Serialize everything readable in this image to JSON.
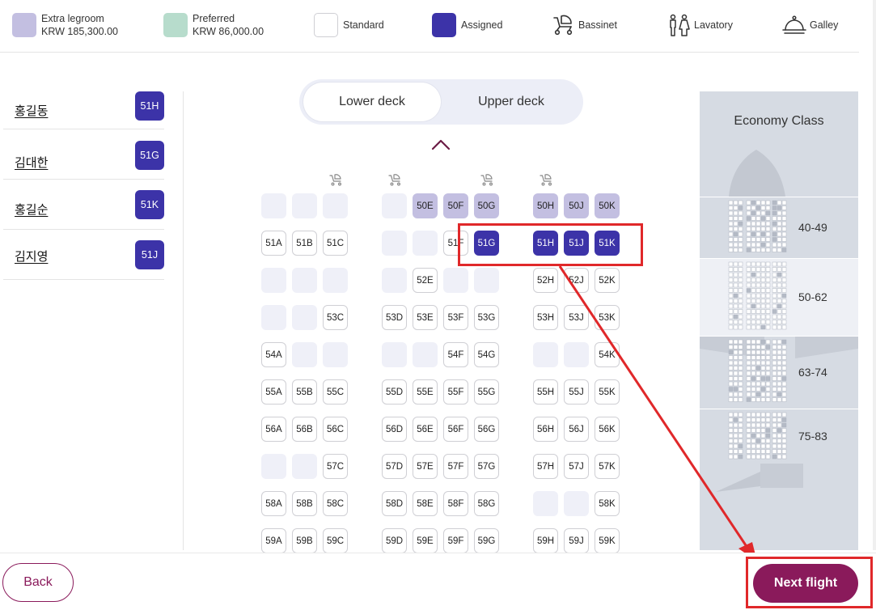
{
  "legend": {
    "extra_legroom": {
      "label": "Extra legroom",
      "price": "KRW 185,300.00",
      "color": "#c3bfe1"
    },
    "preferred": {
      "label": "Preferred",
      "price": "KRW 86,000.00",
      "color": "#b7dccc"
    },
    "standard": {
      "label": "Standard"
    },
    "assigned": {
      "label": "Assigned",
      "color": "#3c33a8"
    },
    "bassinet": {
      "label": "Bassinet",
      "icon": "stroller-icon"
    },
    "lavatory": {
      "label": "Lavatory",
      "icon": "lavatory-icon"
    },
    "galley": {
      "label": "Galley",
      "icon": "cloche-icon"
    }
  },
  "passengers": [
    {
      "name": "홍길동",
      "seat": "51H"
    },
    {
      "name": "김대한",
      "seat": "51G"
    },
    {
      "name": "홍길순",
      "seat": "51K"
    },
    {
      "name": "김지영",
      "seat": "51J"
    }
  ],
  "deck": {
    "lower": "Lower deck",
    "upper": "Upper deck",
    "selected": "Lower deck"
  },
  "seatmap": {
    "bassinet_rows": [
      "50"
    ],
    "rows": [
      {
        "row": "50",
        "seats": [
          {
            "l": "A",
            "s": "na"
          },
          {
            "l": "B",
            "s": "na"
          },
          {
            "l": "C",
            "s": "na"
          },
          {
            "l": "D",
            "s": "na"
          },
          {
            "l": "E",
            "s": "xl",
            "t": "50E"
          },
          {
            "l": "F",
            "s": "xl",
            "t": "50F"
          },
          {
            "l": "G",
            "s": "xl",
            "t": "50G"
          },
          {
            "l": "H",
            "s": "xl",
            "t": "50H"
          },
          {
            "l": "J",
            "s": "xl",
            "t": "50J"
          },
          {
            "l": "K",
            "s": "xl",
            "t": "50K"
          }
        ]
      },
      {
        "row": "51",
        "seats": [
          {
            "l": "A",
            "s": "std",
            "t": "51A"
          },
          {
            "l": "B",
            "s": "std",
            "t": "51B"
          },
          {
            "l": "C",
            "s": "std",
            "t": "51C"
          },
          {
            "l": "D",
            "s": "na"
          },
          {
            "l": "E",
            "s": "na"
          },
          {
            "l": "F",
            "s": "std",
            "t": "51F"
          },
          {
            "l": "G",
            "s": "asg",
            "t": "51G"
          },
          {
            "l": "H",
            "s": "asg",
            "t": "51H"
          },
          {
            "l": "J",
            "s": "asg",
            "t": "51J"
          },
          {
            "l": "K",
            "s": "asg",
            "t": "51K"
          }
        ]
      },
      {
        "row": "52",
        "seats": [
          {
            "l": "A",
            "s": "na"
          },
          {
            "l": "B",
            "s": "na"
          },
          {
            "l": "C",
            "s": "na"
          },
          {
            "l": "D",
            "s": "na"
          },
          {
            "l": "E",
            "s": "std",
            "t": "52E"
          },
          {
            "l": "F",
            "s": "na"
          },
          {
            "l": "G",
            "s": "na"
          },
          {
            "l": "H",
            "s": "std",
            "t": "52H"
          },
          {
            "l": "J",
            "s": "std",
            "t": "52J"
          },
          {
            "l": "K",
            "s": "std",
            "t": "52K"
          }
        ]
      },
      {
        "row": "53",
        "seats": [
          {
            "l": "A",
            "s": "na"
          },
          {
            "l": "B",
            "s": "na"
          },
          {
            "l": "C",
            "s": "std",
            "t": "53C"
          },
          {
            "l": "D",
            "s": "std",
            "t": "53D"
          },
          {
            "l": "E",
            "s": "std",
            "t": "53E"
          },
          {
            "l": "F",
            "s": "std",
            "t": "53F"
          },
          {
            "l": "G",
            "s": "std",
            "t": "53G"
          },
          {
            "l": "H",
            "s": "std",
            "t": "53H"
          },
          {
            "l": "J",
            "s": "std",
            "t": "53J"
          },
          {
            "l": "K",
            "s": "std",
            "t": "53K"
          }
        ]
      },
      {
        "row": "54",
        "seats": [
          {
            "l": "A",
            "s": "std",
            "t": "54A"
          },
          {
            "l": "B",
            "s": "na"
          },
          {
            "l": "C",
            "s": "na"
          },
          {
            "l": "D",
            "s": "na"
          },
          {
            "l": "E",
            "s": "na"
          },
          {
            "l": "F",
            "s": "std",
            "t": "54F"
          },
          {
            "l": "G",
            "s": "std",
            "t": "54G"
          },
          {
            "l": "H",
            "s": "na"
          },
          {
            "l": "J",
            "s": "na"
          },
          {
            "l": "K",
            "s": "std",
            "t": "54K"
          }
        ]
      },
      {
        "row": "55",
        "seats": [
          {
            "l": "A",
            "s": "std",
            "t": "55A"
          },
          {
            "l": "B",
            "s": "std",
            "t": "55B"
          },
          {
            "l": "C",
            "s": "std",
            "t": "55C"
          },
          {
            "l": "D",
            "s": "std",
            "t": "55D"
          },
          {
            "l": "E",
            "s": "std",
            "t": "55E"
          },
          {
            "l": "F",
            "s": "std",
            "t": "55F"
          },
          {
            "l": "G",
            "s": "std",
            "t": "55G"
          },
          {
            "l": "H",
            "s": "std",
            "t": "55H"
          },
          {
            "l": "J",
            "s": "std",
            "t": "55J"
          },
          {
            "l": "K",
            "s": "std",
            "t": "55K"
          }
        ]
      },
      {
        "row": "56",
        "seats": [
          {
            "l": "A",
            "s": "std",
            "t": "56A"
          },
          {
            "l": "B",
            "s": "std",
            "t": "56B"
          },
          {
            "l": "C",
            "s": "std",
            "t": "56C"
          },
          {
            "l": "D",
            "s": "std",
            "t": "56D"
          },
          {
            "l": "E",
            "s": "std",
            "t": "56E"
          },
          {
            "l": "F",
            "s": "std",
            "t": "56F"
          },
          {
            "l": "G",
            "s": "std",
            "t": "56G"
          },
          {
            "l": "H",
            "s": "std",
            "t": "56H"
          },
          {
            "l": "J",
            "s": "std",
            "t": "56J"
          },
          {
            "l": "K",
            "s": "std",
            "t": "56K"
          }
        ]
      },
      {
        "row": "57",
        "seats": [
          {
            "l": "A",
            "s": "na"
          },
          {
            "l": "B",
            "s": "na"
          },
          {
            "l": "C",
            "s": "std",
            "t": "57C"
          },
          {
            "l": "D",
            "s": "std",
            "t": "57D"
          },
          {
            "l": "E",
            "s": "std",
            "t": "57E"
          },
          {
            "l": "F",
            "s": "std",
            "t": "57F"
          },
          {
            "l": "G",
            "s": "std",
            "t": "57G"
          },
          {
            "l": "H",
            "s": "std",
            "t": "57H"
          },
          {
            "l": "J",
            "s": "std",
            "t": "57J"
          },
          {
            "l": "K",
            "s": "std",
            "t": "57K"
          }
        ]
      },
      {
        "row": "58",
        "seats": [
          {
            "l": "A",
            "s": "std",
            "t": "58A"
          },
          {
            "l": "B",
            "s": "std",
            "t": "58B"
          },
          {
            "l": "C",
            "s": "std",
            "t": "58C"
          },
          {
            "l": "D",
            "s": "std",
            "t": "58D"
          },
          {
            "l": "E",
            "s": "std",
            "t": "58E"
          },
          {
            "l": "F",
            "s": "std",
            "t": "58F"
          },
          {
            "l": "G",
            "s": "std",
            "t": "58G"
          },
          {
            "l": "H",
            "s": "na"
          },
          {
            "l": "J",
            "s": "na"
          },
          {
            "l": "K",
            "s": "std",
            "t": "58K"
          }
        ]
      },
      {
        "row": "59",
        "seats": [
          {
            "l": "A",
            "s": "std",
            "t": "59A"
          },
          {
            "l": "B",
            "s": "std",
            "t": "59B"
          },
          {
            "l": "C",
            "s": "std",
            "t": "59C"
          },
          {
            "l": "D",
            "s": "std",
            "t": "59D"
          },
          {
            "l": "E",
            "s": "std",
            "t": "59E"
          },
          {
            "l": "F",
            "s": "std",
            "t": "59F"
          },
          {
            "l": "G",
            "s": "std",
            "t": "59G"
          },
          {
            "l": "H",
            "s": "std",
            "t": "59H"
          },
          {
            "l": "J",
            "s": "std",
            "t": "59J"
          },
          {
            "l": "K",
            "s": "std",
            "t": "59K"
          }
        ]
      }
    ]
  },
  "minimap": {
    "cabin": "Economy Class",
    "sections": [
      "40-49",
      "50-62",
      "63-74",
      "75-83"
    ],
    "selected_section": "50-62"
  },
  "footer": {
    "back": "Back",
    "next": "Next flight"
  }
}
